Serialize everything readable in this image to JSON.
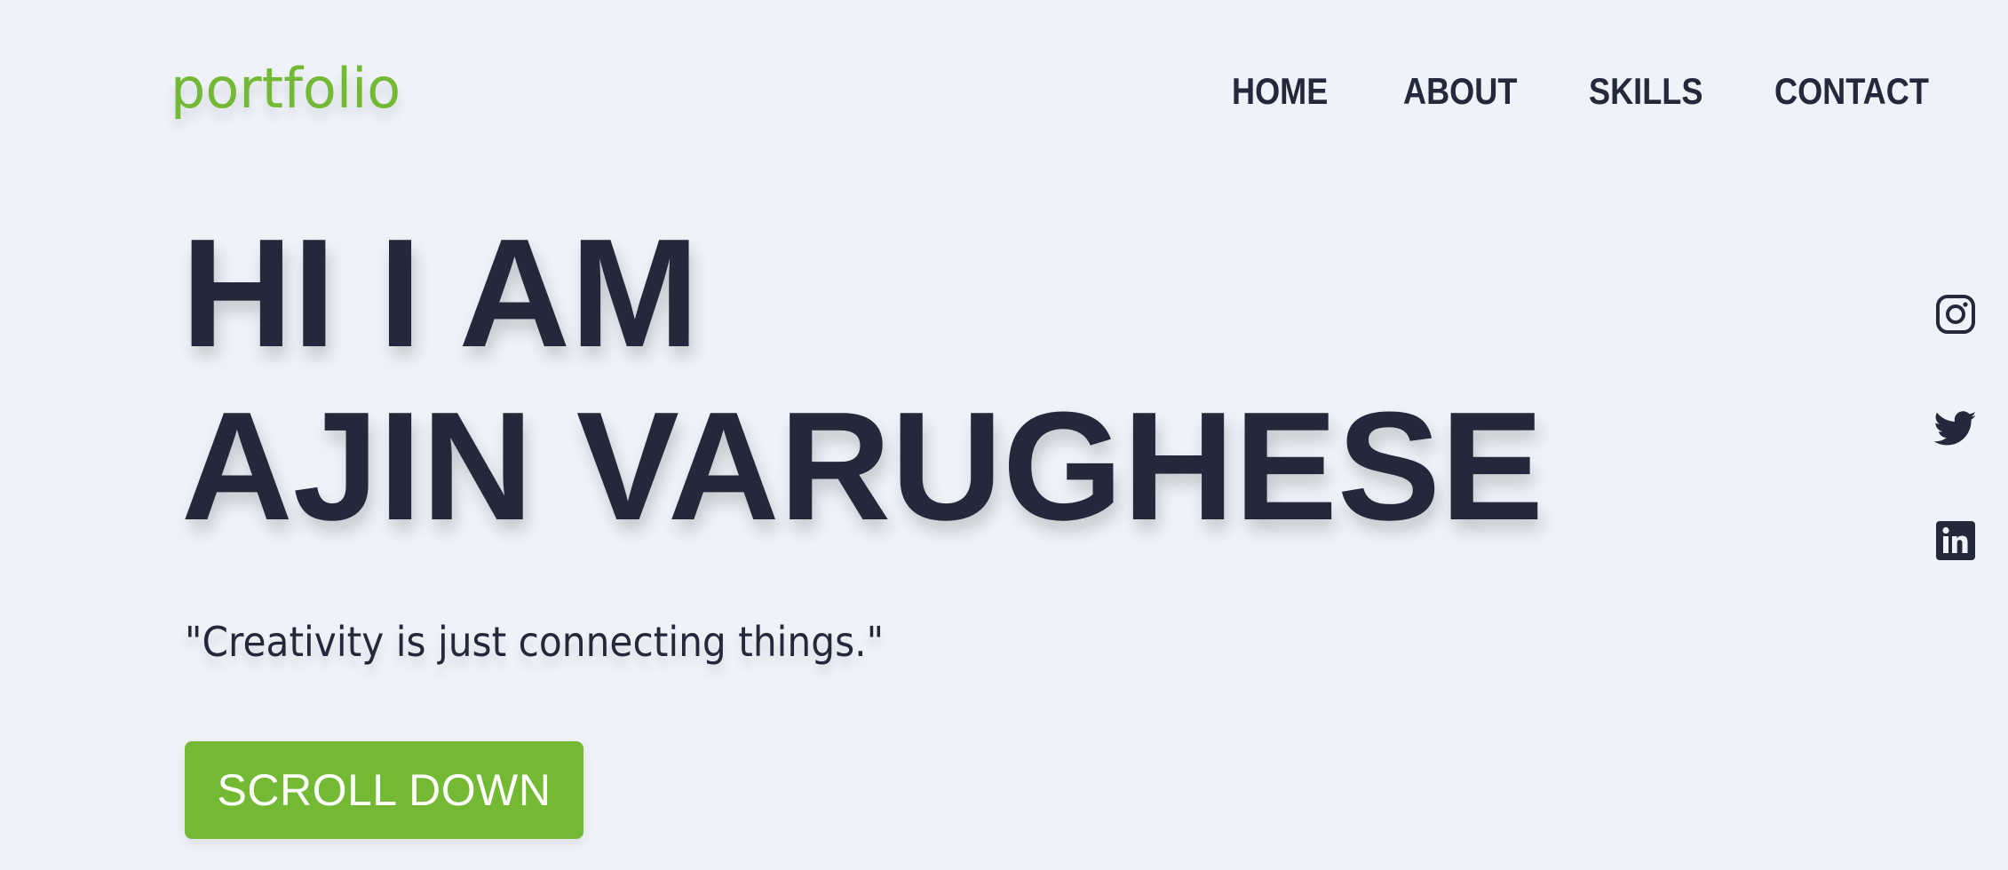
{
  "header": {
    "logo_text": "portfolio",
    "nav": {
      "home": "HOME",
      "about": "ABOUT",
      "skills": "SKILLS",
      "contact": "CONTACT"
    }
  },
  "hero": {
    "line1": "HI I AM",
    "line2": "AJIN VARUGHESE",
    "tagline": "\"Creativity is just connecting things.\"",
    "cta_label": "SCROLL DOWN"
  },
  "social": [
    {
      "icon": "instagram-icon"
    },
    {
      "icon": "twitter-icon"
    },
    {
      "icon": "linkedin-icon"
    }
  ],
  "colors": {
    "background": "#eff3f9",
    "accent": "#73b934",
    "text": "#23283a"
  }
}
